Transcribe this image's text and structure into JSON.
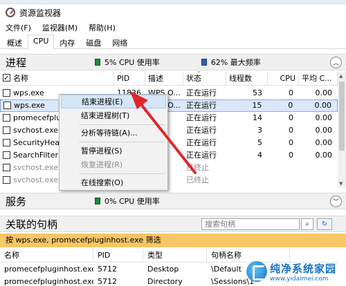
{
  "window": {
    "title": "资源监视器"
  },
  "menu": [
    "文件(F)",
    "监视器(M)",
    "帮助(H)"
  ],
  "tabs": [
    "概述",
    "CPU",
    "内存",
    "磁盘",
    "网络"
  ],
  "processes": {
    "title": "进程",
    "cpu_usage": "5% CPU 使用率",
    "max_freq": "62% 最大频率",
    "columns": [
      "名称",
      "PID",
      "描述",
      "状态",
      "线程数",
      "CPU",
      "平均 C..."
    ],
    "rows": [
      {
        "name": "wps.exe",
        "pid": "11836",
        "desc": "WPS O...",
        "status": "正在运行",
        "threads": "53",
        "cpu": "0",
        "avg": "0.00"
      },
      {
        "name": "wps.exe",
        "pid": "",
        "desc": "WPS O...",
        "status": "正在运行",
        "threads": "15",
        "cpu": "0",
        "avg": "0.00"
      },
      {
        "name": "promecefpluginho",
        "pid": "",
        "desc": "",
        "status": "正在运行",
        "threads": "14",
        "cpu": "0",
        "avg": "0.00"
      },
      {
        "name": "svchost.exe (",
        "pid": "",
        "desc": "",
        "status": "正在运行",
        "threads": "3",
        "cpu": "0",
        "avg": "0.00"
      },
      {
        "name": "SecurityHealt",
        "pid": "",
        "desc": "",
        "status": "正在运行",
        "threads": "5",
        "cpu": "0",
        "avg": "0.00"
      },
      {
        "name": "SearchFilterH",
        "pid": "",
        "desc": "",
        "status": "正在运行",
        "threads": "4",
        "cpu": "0",
        "avg": "0.00"
      },
      {
        "name": "svchost.exe (",
        "pid": "",
        "desc": "",
        "status": "已终止",
        "threads": "",
        "cpu": "",
        "avg": ""
      },
      {
        "name": "svchost.exe (",
        "pid": "",
        "desc": "",
        "status": "已终止",
        "threads": "",
        "cpu": "",
        "avg": ""
      }
    ]
  },
  "context_menu": {
    "items": [
      "结束进程(E)",
      "结束进程树(T)",
      "分析等待链(A)...",
      "暂停进程(S)",
      "恢复进程(R)",
      "在线搜索(O)"
    ]
  },
  "services": {
    "title": "服务",
    "cpu_usage": "0% CPU 使用率"
  },
  "handles": {
    "title": "关联的句柄",
    "search_placeholder": "搜索句柄",
    "filter_text": "按 wps.exe, promecefpluginhost.exe 筛选",
    "columns": [
      "名称",
      "PID",
      "类型",
      "句柄名称"
    ],
    "rows": [
      {
        "name": "promecefpluginhost.exe",
        "pid": "5712",
        "type": "Desktop",
        "handle": "\\Default"
      },
      {
        "name": "promecefpluginhost.exe",
        "pid": "5712",
        "type": "Directory",
        "handle": "\\Sessions\\1"
      }
    ]
  },
  "watermark": {
    "title": "纯净系统家园",
    "url": "www.yidaimei.com"
  }
}
